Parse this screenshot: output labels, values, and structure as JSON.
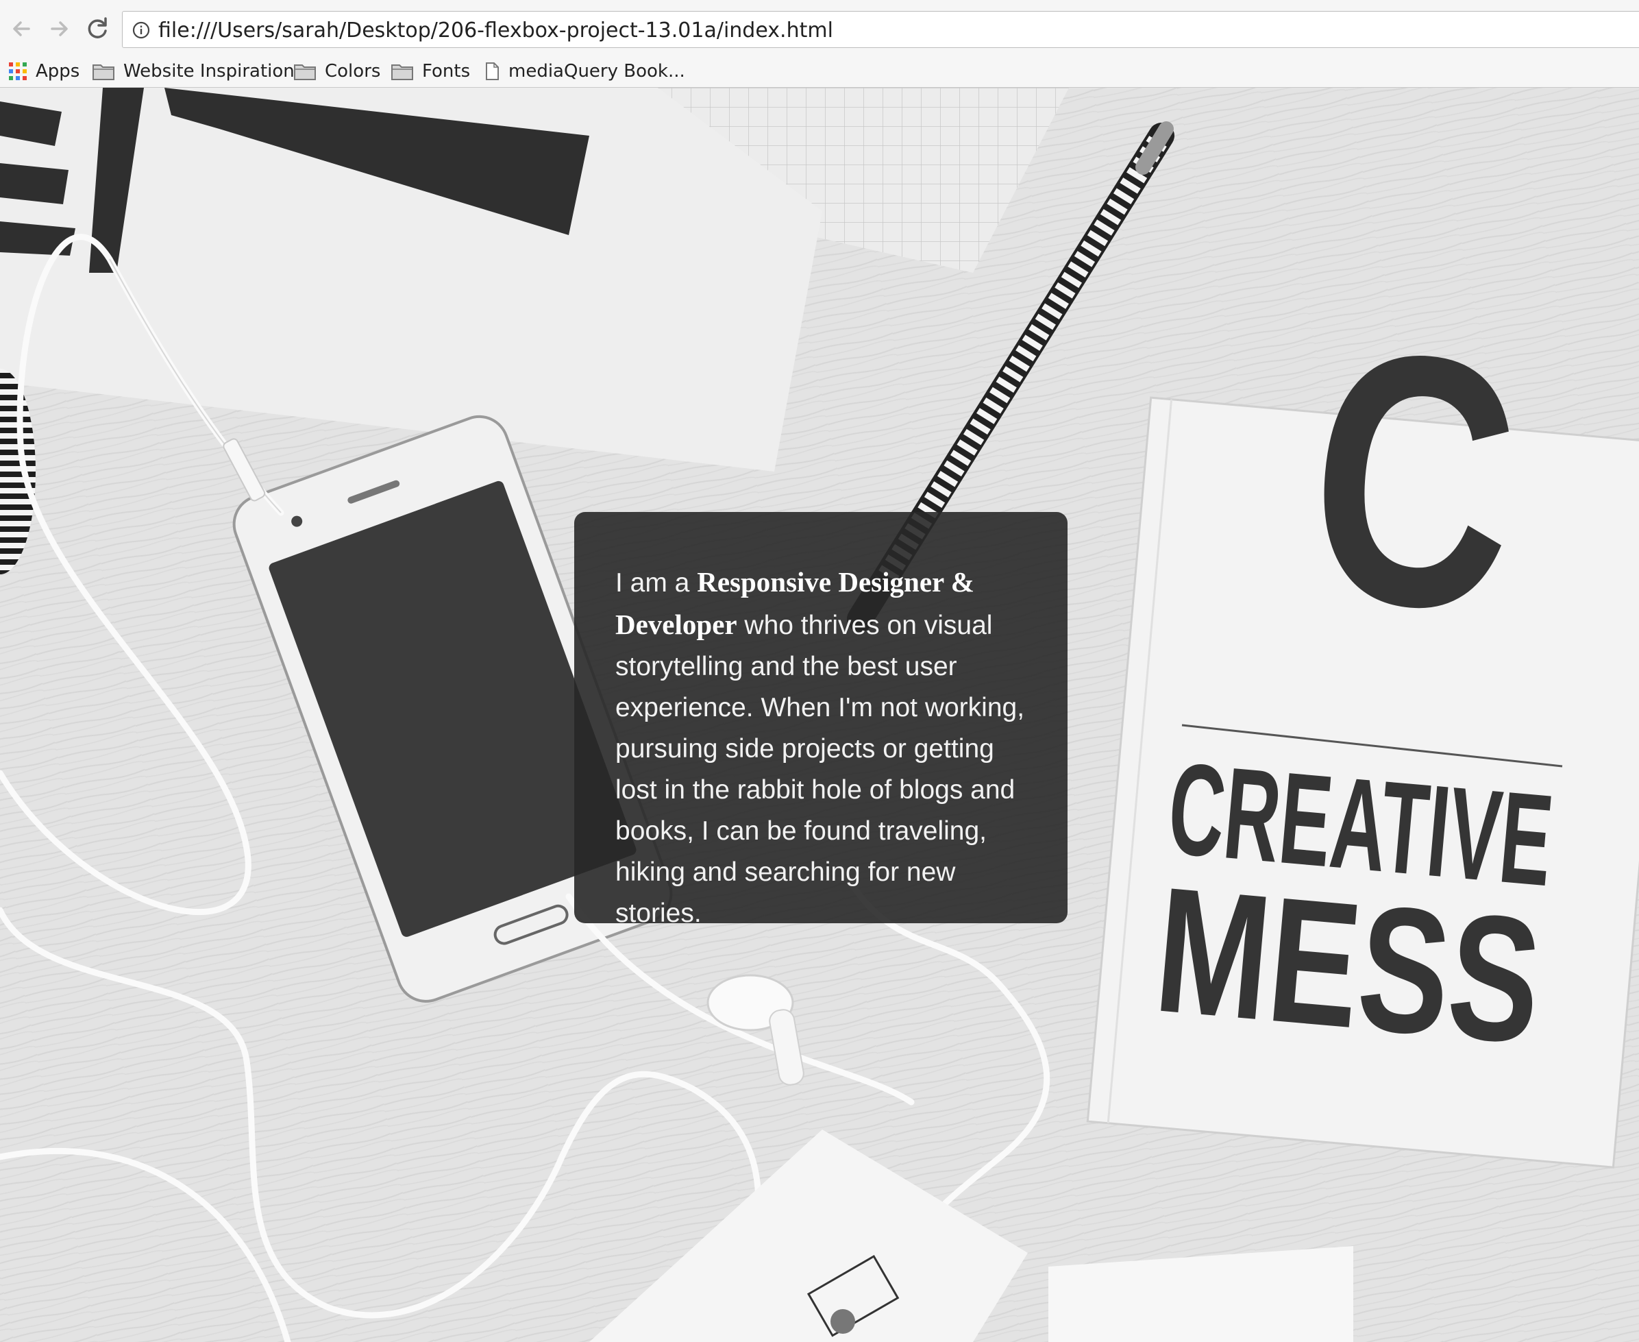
{
  "browser": {
    "url": "file:///Users/sarah/Desktop/206-flexbox-project-13.01a/index.html",
    "bookmarks": [
      {
        "label": "Apps",
        "icon": "apps-grid-icon"
      },
      {
        "label": "Website Inspiration",
        "icon": "folder-icon"
      },
      {
        "label": "Colors",
        "icon": "folder-icon"
      },
      {
        "label": "Fonts",
        "icon": "folder-icon"
      },
      {
        "label": "mediaQuery Book...",
        "icon": "page-icon"
      }
    ]
  },
  "hero": {
    "notebook_letter": "C",
    "notebook_line1": "CREATIVE",
    "notebook_line2": "MESS"
  },
  "intro": {
    "prefix": "I am a ",
    "highlight": "Responsive Designer & Developer",
    "body": " who thrives on visual storytelling and the best user experience. When I'm not working, pursuing side projects or getting lost in the rabbit hole of blogs and books, I can be found traveling, hiking and searching for new stories."
  }
}
